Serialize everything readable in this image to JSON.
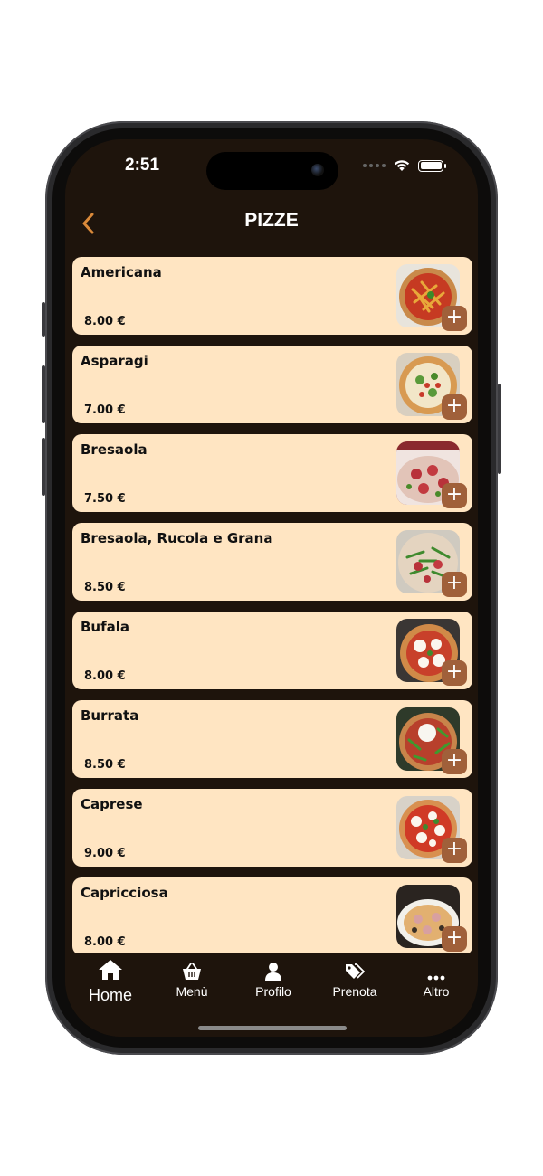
{
  "status_bar": {
    "time": "2:51"
  },
  "header": {
    "title": "PIZZE",
    "back_icon": "chevron-left-icon"
  },
  "colors": {
    "background": "#1e140c",
    "card": "#ffe5c2",
    "accent": "#a0603a",
    "back_arrow": "#d9893a"
  },
  "items": [
    {
      "name": "Americana",
      "price": "8.00 €"
    },
    {
      "name": "Asparagi",
      "price": "7.00 €"
    },
    {
      "name": "Bresaola",
      "price": "7.50 €"
    },
    {
      "name": "Bresaola, Rucola e Grana",
      "price": "8.50 €"
    },
    {
      "name": "Bufala",
      "price": "8.00 €"
    },
    {
      "name": "Burrata",
      "price": "8.50 €"
    },
    {
      "name": "Caprese",
      "price": "9.00 €"
    },
    {
      "name": "Capricciosa",
      "price": "8.00 €"
    }
  ],
  "add_label": "+",
  "tabbar": [
    {
      "label": "Home",
      "icon": "home-icon",
      "active": true
    },
    {
      "label": "Menù",
      "icon": "basket-icon"
    },
    {
      "label": "Profilo",
      "icon": "user-icon"
    },
    {
      "label": "Prenota",
      "icon": "tags-icon"
    },
    {
      "label": "Altro",
      "icon": "more-icon"
    }
  ]
}
